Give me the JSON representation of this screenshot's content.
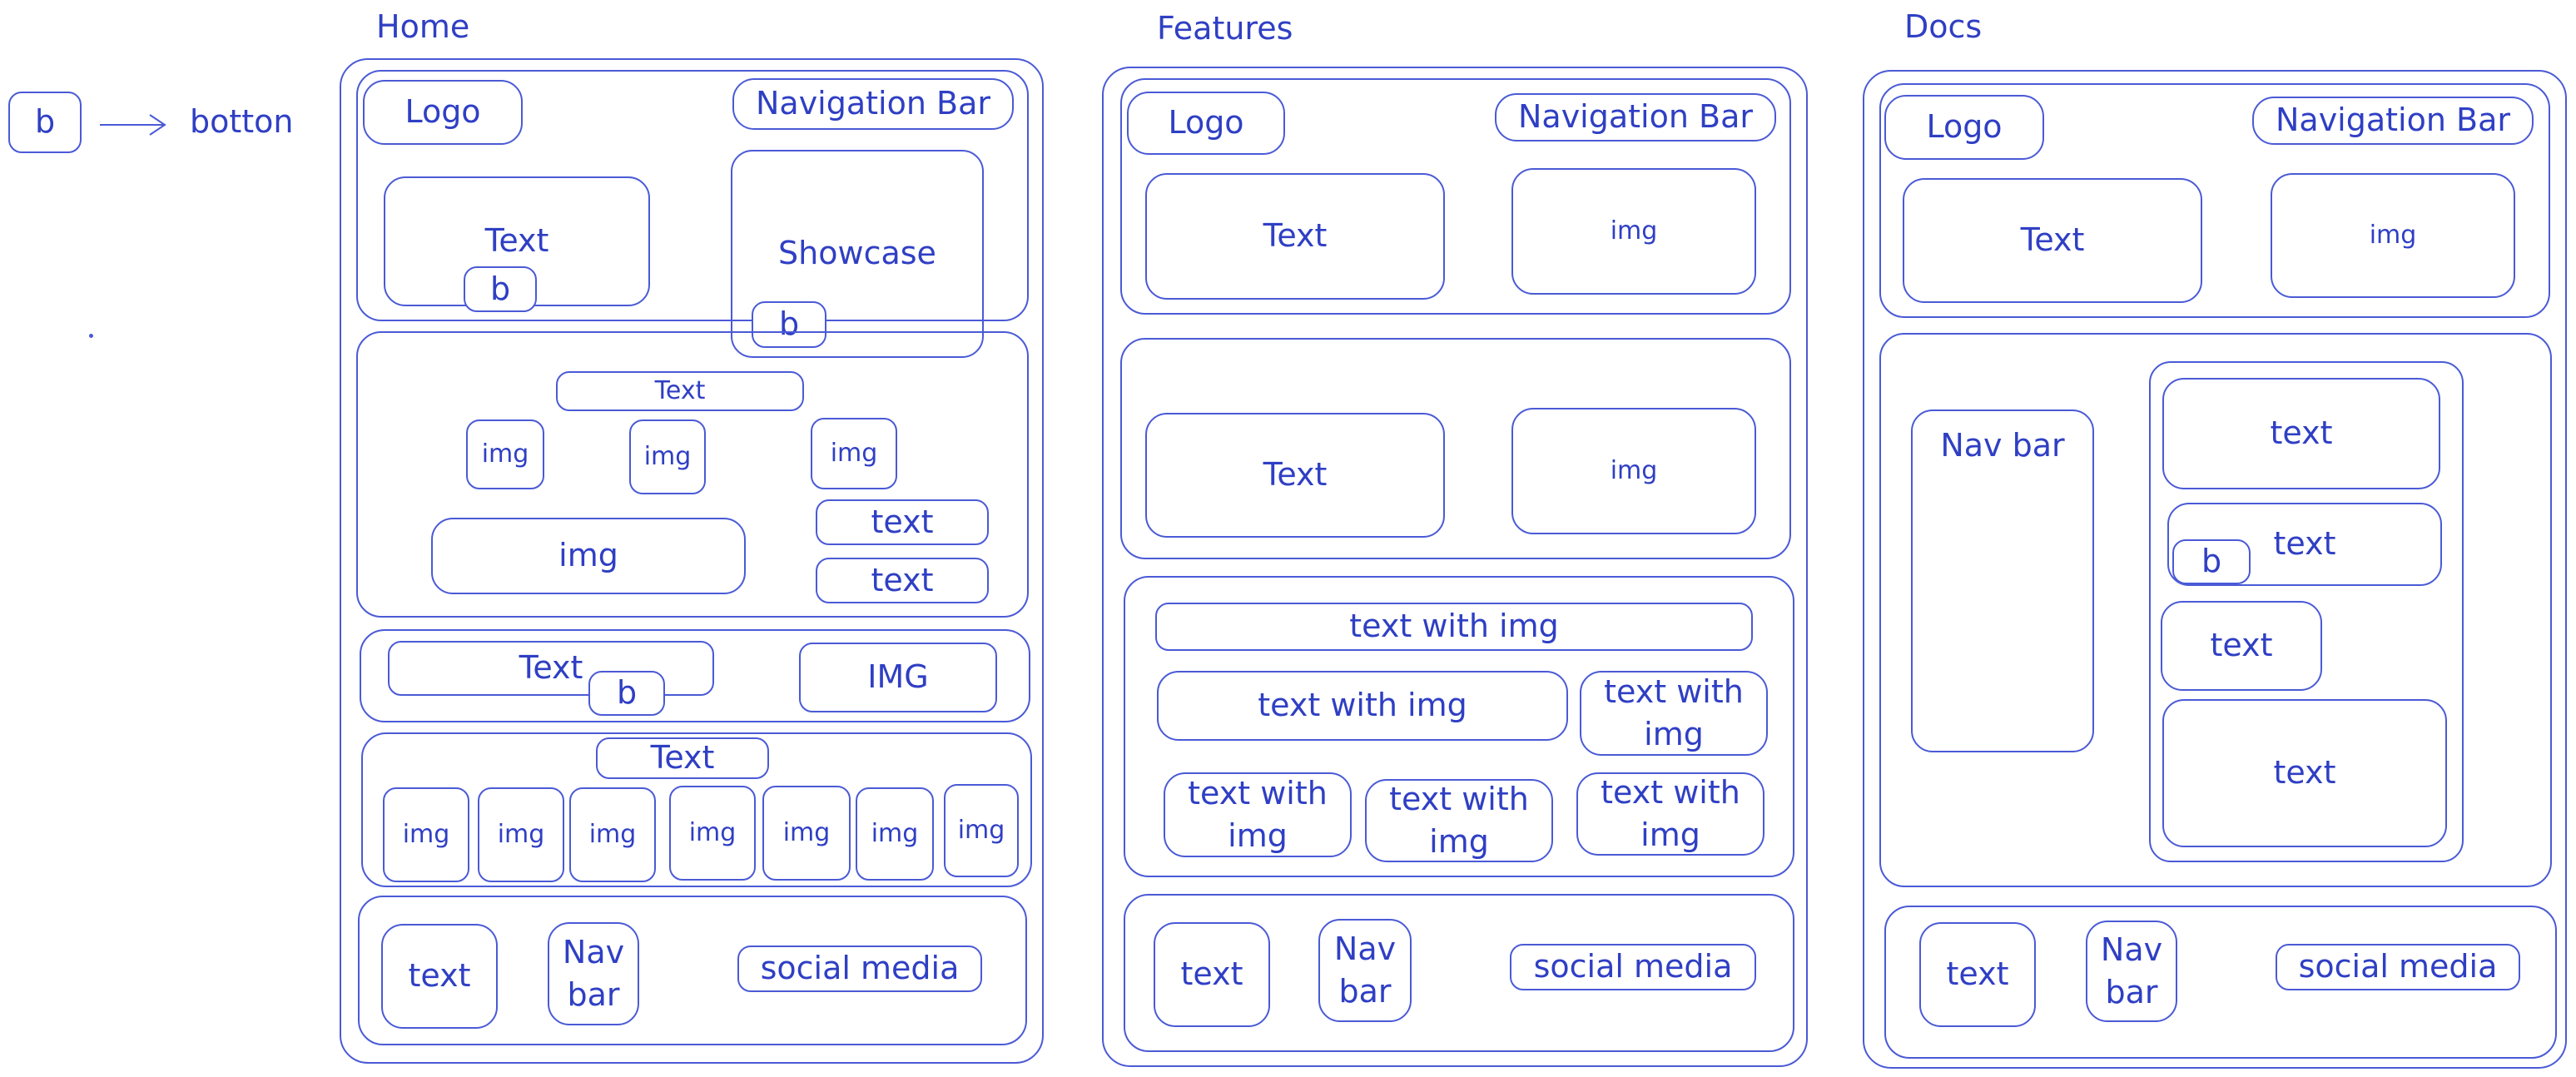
{
  "legend": {
    "button_glyph": "b",
    "button_meaning": "botton"
  },
  "home": {
    "label": "Home",
    "header": {
      "logo": "Logo",
      "nav": "Navigation Bar",
      "text": "Text",
      "showcase": "Showcase",
      "btn1": "b",
      "btn2": "b"
    },
    "section2": {
      "title": "Text",
      "img1": "img",
      "img2": "img",
      "img3": "img",
      "wide_img": "img",
      "text1": "text",
      "text2": "text"
    },
    "section3": {
      "text": "Text",
      "btn": "b",
      "img": "IMG"
    },
    "section4": {
      "title": "Text",
      "imgs": [
        "img",
        "img",
        "img",
        "img",
        "img",
        "img",
        "img"
      ]
    },
    "footer": {
      "text": "text",
      "nav": "Nav\nbar",
      "social": "social media"
    }
  },
  "features": {
    "label": "Features",
    "header": {
      "logo": "Logo",
      "nav": "Navigation Bar",
      "text": "Text",
      "img": "img"
    },
    "section2": {
      "text": "Text",
      "img": "img"
    },
    "section3": {
      "top": "text with img",
      "mid_wide": "text with img",
      "mid_right": "text with\nimg",
      "b1": "text with\nimg",
      "b2": "text with\nimg",
      "b3": "text with\nimg"
    },
    "footer": {
      "text": "text",
      "nav": "Nav\nbar",
      "social": "social media"
    }
  },
  "docs": {
    "label": "Docs",
    "header": {
      "logo": "Logo",
      "nav": "Navigation Bar",
      "text": "Text",
      "img": "img"
    },
    "body": {
      "nav": "Nav bar",
      "t1": "text",
      "t2": "text",
      "btn": "b",
      "t3": "text",
      "t4": "text"
    },
    "footer": {
      "text": "text",
      "nav": "Nav\nbar",
      "social": "social media"
    }
  }
}
